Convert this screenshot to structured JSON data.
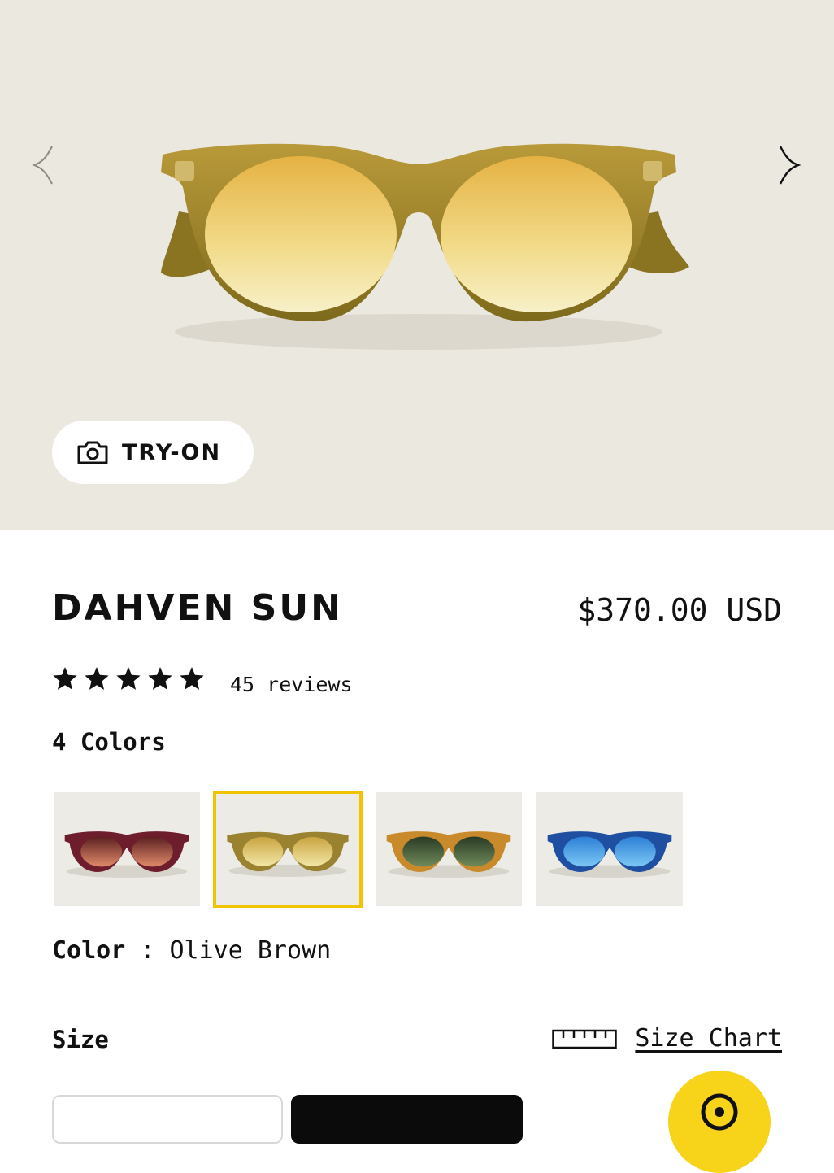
{
  "gallery": {
    "try_on_label": "TRY-ON",
    "prev_icon": "chevron-left-icon",
    "next_icon": "chevron-right-icon",
    "camera_icon": "camera-icon",
    "background": "#ebe8e0"
  },
  "product": {
    "name": "DAHVEN SUN",
    "price": "$370.00 USD",
    "rating": 5,
    "reviews": "45 reviews",
    "colors_count": "4 Colors",
    "color_label": "Color",
    "color_separator": " : ",
    "color_value": "Olive Brown",
    "swatches": [
      {
        "frame": "#6e1d2c",
        "lens_top": "#5a2020",
        "lens_bottom": "#e08a6a",
        "selected": false
      },
      {
        "frame": "#9a8230",
        "lens_top": "#c9a440",
        "lens_bottom": "#f2e6a6",
        "selected": true
      },
      {
        "frame": "#c98a2c",
        "lens_top": "#2a3a24",
        "lens_bottom": "#6f8a5a",
        "selected": false
      },
      {
        "frame": "#1f4fa0",
        "lens_top": "#2c7fd6",
        "lens_bottom": "#7cc8f5",
        "selected": false
      }
    ]
  },
  "size": {
    "label": "Size",
    "chart_label": "Size Chart",
    "ruler_icon": "ruler-icon"
  },
  "colors": {
    "accent": "#f1c400",
    "help_button": "#f7d31a",
    "text": "#111111"
  }
}
